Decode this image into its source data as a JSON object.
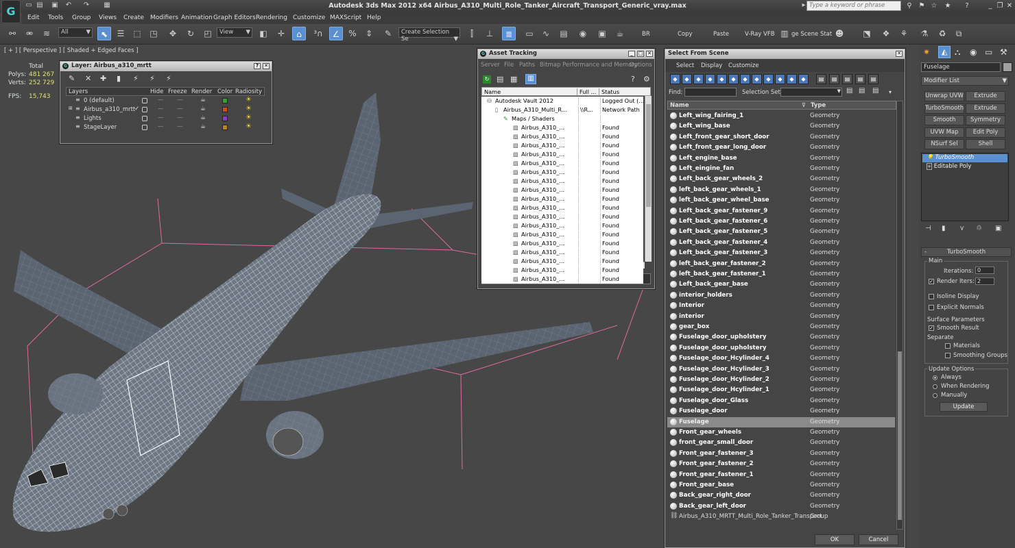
{
  "window": {
    "title": "Autodesk 3ds Max  2012 x64      Airbus_A310_Multi_Role_Tanker_Aircraft_Transport_Generic_vray.max",
    "search_placeholder": "Type a keyword or phrase"
  },
  "menu": [
    "Edit",
    "Tools",
    "Group",
    "Views",
    "Create",
    "Modifiers",
    "Animation",
    "Graph Editors",
    "Rendering",
    "Customize",
    "MAXScript",
    "Help"
  ],
  "toolbar": {
    "selection_filter": "All",
    "ref_coord": "View",
    "named_selection": "Create Selection Se",
    "labels": [
      "BR",
      "Copy",
      "Paste",
      "V-Ray VFB",
      "ge Scene Stat"
    ]
  },
  "viewport": {
    "label": "[ + ] [ Perspective ] [ Shaded + Edged Faces ]",
    "stats": {
      "header": "Total",
      "polys_label": "Polys:",
      "polys": "481 267",
      "verts_label": "Verts:",
      "verts": "252 729",
      "fps_label": "FPS:",
      "fps": "15,743"
    }
  },
  "layer_dialog": {
    "title": "Layer: Airbus_a310_mrtt",
    "columns": [
      "Layers",
      "Hide",
      "Freeze",
      "Render",
      "Color",
      "Radiosity"
    ],
    "layers": [
      {
        "name": "0 (default)",
        "color": "#3b9e3b"
      },
      {
        "name": "Airbus_a310_mrtt",
        "color": "#c8501e"
      },
      {
        "name": "Lights",
        "color": "#8a3cc8"
      },
      {
        "name": "StageLayer",
        "color": "#b8861a"
      }
    ]
  },
  "asset_dialog": {
    "title": "Asset Tracking",
    "menu": [
      "Server",
      "File",
      "Paths",
      "Bitmap Performance and Memory",
      "Options"
    ],
    "columns": [
      "Name",
      "Full ...",
      "Status"
    ],
    "rows": [
      {
        "name": "Autodesk Vault 2012",
        "full": "",
        "status": "Logged Out (..."
      },
      {
        "name": "Airbus_A310_Multi_R...",
        "full": "\\\\R...",
        "status": "Network Path"
      },
      {
        "name": "Maps / Shaders",
        "full": "",
        "status": ""
      },
      {
        "name": "Airbus_A310_...",
        "full": "",
        "status": "Found"
      },
      {
        "name": "Airbus_A310_...",
        "full": "",
        "status": "Found"
      },
      {
        "name": "Airbus_A310_...",
        "full": "",
        "status": "Found"
      },
      {
        "name": "Airbus_A310_...",
        "full": "",
        "status": "Found"
      },
      {
        "name": "Airbus_A310_...",
        "full": "",
        "status": "Found"
      },
      {
        "name": "Airbus_A310_...",
        "full": "",
        "status": "Found"
      },
      {
        "name": "Airbus_A310_...",
        "full": "",
        "status": "Found"
      },
      {
        "name": "Airbus_A310_...",
        "full": "",
        "status": "Found"
      },
      {
        "name": "Airbus_A310_...",
        "full": "",
        "status": "Found"
      },
      {
        "name": "Airbus_A310_...",
        "full": "",
        "status": "Found"
      },
      {
        "name": "Airbus_A310_...",
        "full": "",
        "status": "Found"
      },
      {
        "name": "Airbus_A310_...",
        "full": "",
        "status": "Found"
      },
      {
        "name": "Airbus_A310_...",
        "full": "",
        "status": "Found"
      },
      {
        "name": "Airbus_A310_...",
        "full": "",
        "status": "Found"
      },
      {
        "name": "Airbus_A310_...",
        "full": "",
        "status": "Found"
      },
      {
        "name": "Airbus_A310_...",
        "full": "",
        "status": "Found"
      },
      {
        "name": "Airbus_A310_...",
        "full": "",
        "status": "Found"
      },
      {
        "name": "Airbus_A310_...",
        "full": "",
        "status": "Found"
      }
    ]
  },
  "select_dialog": {
    "title": "Select From Scene",
    "tabs": [
      "Select",
      "Display",
      "Customize"
    ],
    "find_label": "Find:",
    "selection_set_label": "Selection Set:",
    "columns": [
      "Name",
      "Type"
    ],
    "rows": [
      {
        "name": "Left_wing_fairing_1",
        "type": "Geometry"
      },
      {
        "name": "Left_wing_base",
        "type": "Geometry"
      },
      {
        "name": "Left_front_gear_short_door",
        "type": "Geometry"
      },
      {
        "name": "Left_front_gear_long_door",
        "type": "Geometry"
      },
      {
        "name": "Left_engine_base",
        "type": "Geometry"
      },
      {
        "name": "Left_eingine_fan",
        "type": "Geometry"
      },
      {
        "name": "Left_back_gear_wheels_2",
        "type": "Geometry"
      },
      {
        "name": "left_back_gear_wheels_1",
        "type": "Geometry"
      },
      {
        "name": "left_back_gear_wheel_base",
        "type": "Geometry"
      },
      {
        "name": "Left_back_gear_fastener_9",
        "type": "Geometry"
      },
      {
        "name": "Left_back_gear_fastener_6",
        "type": "Geometry"
      },
      {
        "name": "Left_back_gear_fastener_5",
        "type": "Geometry"
      },
      {
        "name": "Left_back_gear_fastener_4",
        "type": "Geometry"
      },
      {
        "name": "Left_back_gear_fastener_3",
        "type": "Geometry"
      },
      {
        "name": "left_back_gear_fastener_2",
        "type": "Geometry"
      },
      {
        "name": "left_back_gear_fastener_1",
        "type": "Geometry"
      },
      {
        "name": "Left_back_gear_base",
        "type": "Geometry"
      },
      {
        "name": "interior_holders",
        "type": "Geometry"
      },
      {
        "name": "Interior",
        "type": "Geometry"
      },
      {
        "name": "interior",
        "type": "Geometry"
      },
      {
        "name": "gear_box",
        "type": "Geometry"
      },
      {
        "name": "Fuselage_door_upholstery",
        "type": "Geometry"
      },
      {
        "name": "Fuselage_door_upholstery",
        "type": "Geometry"
      },
      {
        "name": "Fuselage_door_Hcylinder_4",
        "type": "Geometry"
      },
      {
        "name": "Fuselage_door_Hcylinder_3",
        "type": "Geometry"
      },
      {
        "name": "Fuselage_door_Hcylinder_2",
        "type": "Geometry"
      },
      {
        "name": "Fuselage_door_Hcylinder_1",
        "type": "Geometry"
      },
      {
        "name": "Fuselage_door_Glass",
        "type": "Geometry"
      },
      {
        "name": "Fuselage_door",
        "type": "Geometry"
      },
      {
        "name": "Fuselage",
        "type": "Geometry",
        "selected": true
      },
      {
        "name": "Front_gear_wheels",
        "type": "Geometry"
      },
      {
        "name": "front_gear_small_door",
        "type": "Geometry"
      },
      {
        "name": "Front_gear_fastener_3",
        "type": "Geometry"
      },
      {
        "name": "Front_gear_fastener_2",
        "type": "Geometry"
      },
      {
        "name": "Front_gear_fastener_1",
        "type": "Geometry"
      },
      {
        "name": "Front_gear_base",
        "type": "Geometry"
      },
      {
        "name": "Back_gear_right_door",
        "type": "Geometry"
      },
      {
        "name": "Back_gear_left_door",
        "type": "Geometry"
      },
      {
        "name": "Airbus_A310_MRTT_Multi_Role_Tanker_Transport",
        "type": "Group",
        "group": true
      }
    ],
    "ok_label": "OK",
    "cancel_label": "Cancel"
  },
  "command_panel": {
    "object_name": "Fuselage",
    "object_color": "#a0a0a0",
    "modifier_list": "Modifier List",
    "mod_buttons": [
      "Unwrap UVW",
      "Extrude",
      "TurboSmooth",
      "Extrude",
      "Smooth",
      "Symmetry",
      "UVW Map",
      "Edit Poly",
      "NSurf Sel",
      "Shell"
    ],
    "stack": [
      "TurboSmooth",
      "Editable Poly"
    ],
    "rollout_title": "TurboSmooth",
    "main_label": "Main",
    "iterations_label": "Iterations:",
    "iterations": "0",
    "render_iters_label": "Render Iters:",
    "render_iters": "2",
    "isoline_label": "Isoline Display",
    "explicit_label": "Explicit Normals",
    "surface_label": "Surface Parameters",
    "smooth_result_label": "Smooth Result",
    "separate_label": "Separate",
    "materials_label": "Materials",
    "smoothing_groups_label": "Smoothing Groups",
    "update_options_label": "Update Options",
    "always_label": "Always",
    "when_rendering_label": "When Rendering",
    "manually_label": "Manually",
    "update_button": "Update"
  }
}
